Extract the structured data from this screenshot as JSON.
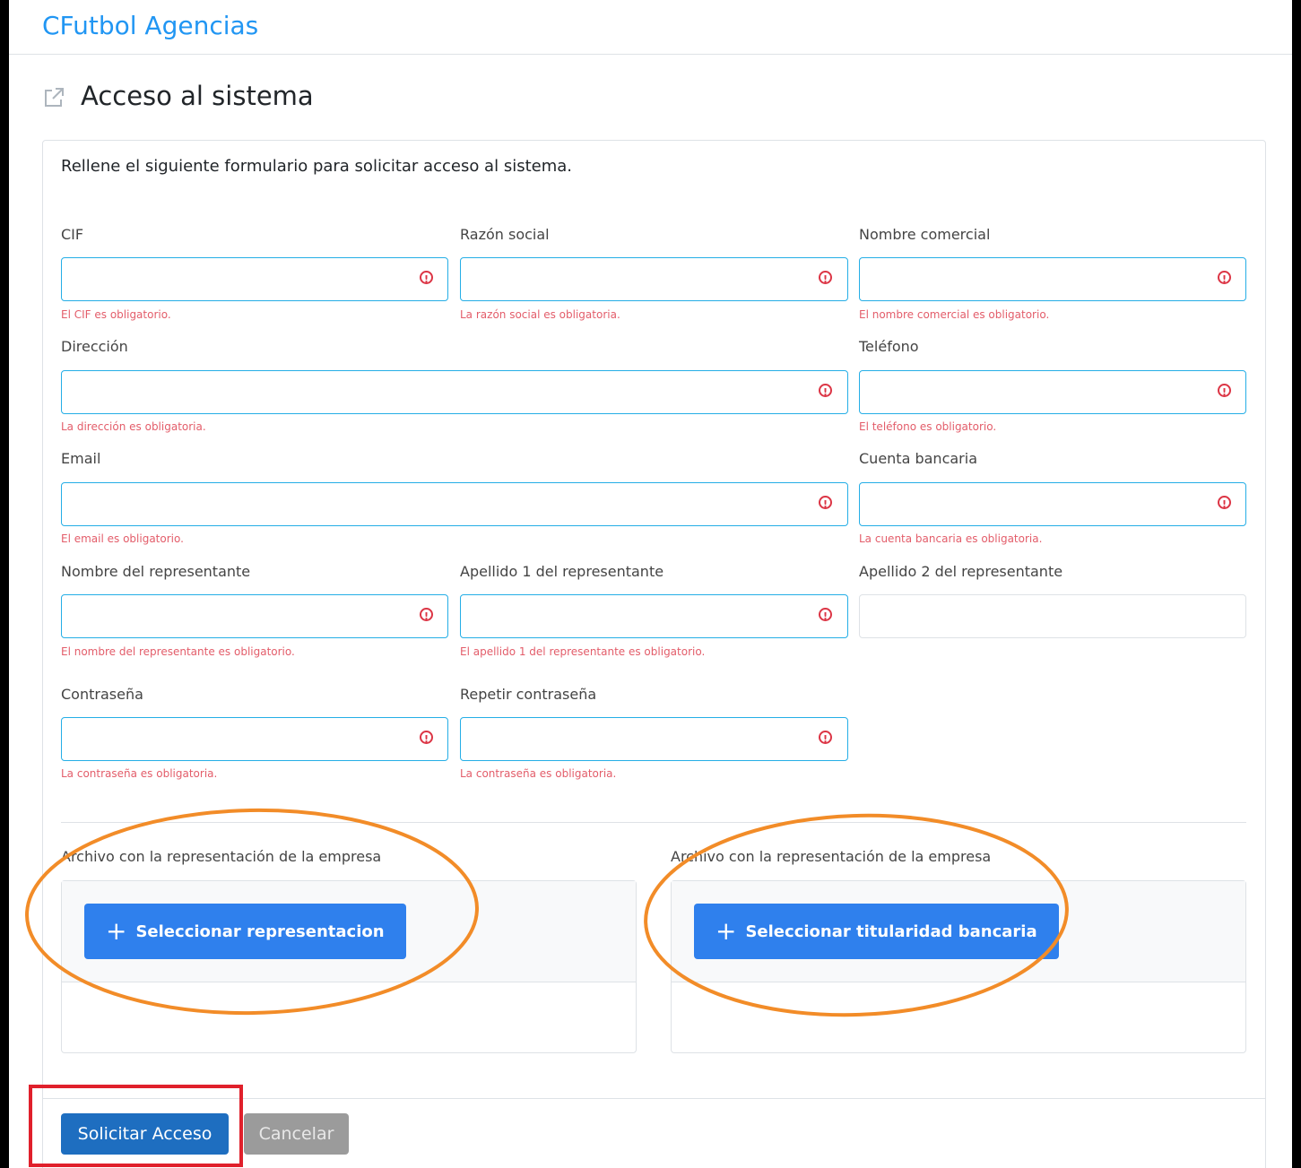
{
  "header": {
    "brand": "CFutbol Agencias"
  },
  "page": {
    "title": "Acceso al sistema",
    "intro": "Rellene el siguiente formulario para solicitar acceso al sistema."
  },
  "form": {
    "cif": {
      "label": "CIF",
      "error": "El CIF es obligatorio."
    },
    "razon_social": {
      "label": "Razón social",
      "error": "La razón social es obligatoria."
    },
    "nombre_comercial": {
      "label": "Nombre comercial",
      "error": "El nombre comercial es obligatorio."
    },
    "direccion": {
      "label": "Dirección",
      "error": "La dirección es obligatoria."
    },
    "telefono": {
      "label": "Teléfono",
      "error": "El teléfono es obligatorio."
    },
    "email": {
      "label": "Email",
      "error": "El email es obligatorio."
    },
    "cuenta_bancaria": {
      "label": "Cuenta bancaria",
      "error": "La cuenta bancaria es obligatoria."
    },
    "nombre_representante": {
      "label": "Nombre del representante",
      "error": "El nombre del representante es obligatorio."
    },
    "apellido1": {
      "label": "Apellido 1 del representante",
      "error": "El apellido 1 del representante es obligatorio."
    },
    "apellido2": {
      "label": "Apellido 2 del representante"
    },
    "contrasena": {
      "label": "Contraseña",
      "error": "La contraseña es obligatoria."
    },
    "repetir_contrasena": {
      "label": "Repetir contraseña",
      "error": "La contraseña es obligatoria."
    }
  },
  "uploads": {
    "representacion": {
      "label": "Archivo con la representación de la empresa",
      "button": "Seleccionar representacion"
    },
    "titularidad": {
      "label": "Archivo con la representación de la empresa",
      "button": "Seleccionar titularidad bancaria"
    }
  },
  "actions": {
    "submit": "Solicitar Acceso",
    "cancel": "Cancelar"
  },
  "colors": {
    "brand": "#2196f3",
    "input_border": "#25aee6",
    "error": "#dc3545",
    "upload_button": "#2f80ed",
    "submit_button": "#1e6ec0",
    "cancel_button": "#9b9b9b",
    "annotation_orange": "#f28c28",
    "annotation_red": "#e0202b"
  }
}
